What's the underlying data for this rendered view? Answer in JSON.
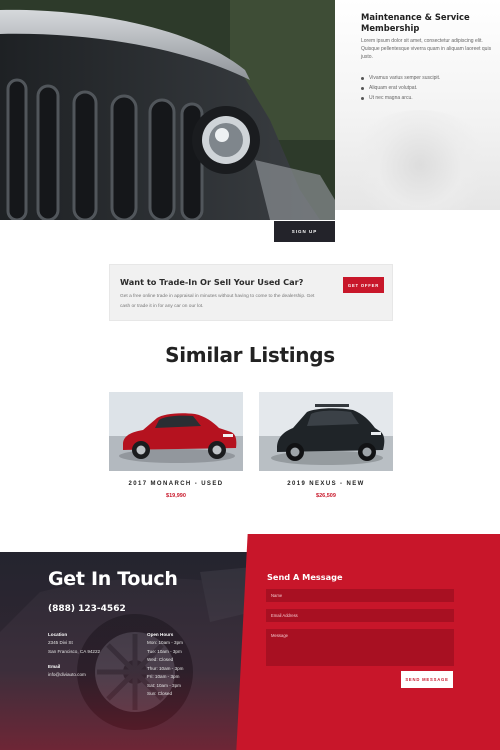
{
  "hero": {
    "membership_title": "Maintenance & Service Membership",
    "membership_text": "Lorem ipsum dolor sit amet, consectetur adipiscing elit. Quisque pellentesque viverra quam in aliquam laoreet quis justo.",
    "bullets": [
      "Vivamus varius semper suscipit.",
      "Aliquam erat volutpat.",
      "Ut nec magna arcu."
    ],
    "signup_label": "SIGN UP"
  },
  "trade": {
    "title": "Want to Trade-In Or Sell Your Used Car?",
    "text": "Get a free online trade in appraisal in minutes without having to come to the dealership. Get cash or trade it in for any car on our lot.",
    "button_label": "GET OFFER"
  },
  "similar": {
    "title": "Similar Listings",
    "listings": [
      {
        "name": "2017 MONARCH - USED",
        "price": "$19,990",
        "color": "#b5121f"
      },
      {
        "name": "2019 NEXUS - NEW",
        "price": "$26,509",
        "color": "#1f2428"
      }
    ]
  },
  "contact": {
    "title": "Get In Touch",
    "phone": "(888) 123-4562",
    "location_label": "Location",
    "location_lines": [
      "2345 Divi St",
      "San Francisco, CA 94222"
    ],
    "email_label": "Email",
    "email": "info@diviauto.com",
    "hours_label": "Open Hours",
    "hours": [
      "Mon: 10am - 3pm",
      "Tue: 10am - 3pm",
      "Wed: Closed",
      "Thur: 10am - 3pm",
      "Fri: 10am - 3pm",
      "Sat: 10am - 3pm",
      "Sun: Closed"
    ]
  },
  "form": {
    "title": "Send A Message",
    "name_placeholder": "Name",
    "email_placeholder": "Email Address",
    "message_placeholder": "Message",
    "send_label": "SEND MESSAGE"
  },
  "colors": {
    "brand_red": "#c8162a",
    "dark": "#23232a"
  }
}
